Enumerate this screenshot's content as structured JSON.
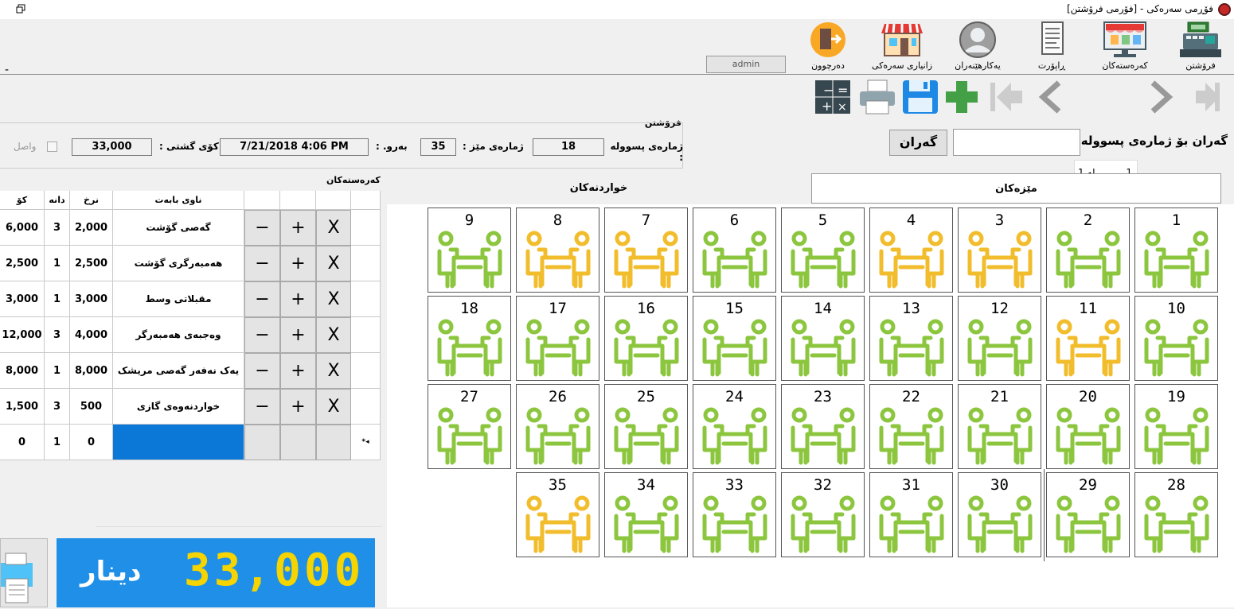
{
  "window": {
    "title": "فۆڕمی سەرەکی - [فۆرمی فرۆشتن]"
  },
  "menu": {
    "items": [
      {
        "label": "فرۆشتن",
        "icon": "cash-register-icon"
      },
      {
        "label": "کەرەستەکان",
        "icon": "monitor-store-icon"
      },
      {
        "label": "ڕاپۆرت",
        "icon": "report-icon"
      },
      {
        "label": "یەکارهێنەران",
        "icon": "user-icon"
      },
      {
        "label": "زانیاری سەرەکی",
        "icon": "shop-icon"
      },
      {
        "label": "دەرچوون",
        "icon": "exit-door-icon"
      }
    ],
    "user": "admin",
    "left_mark": "-"
  },
  "toolbar": {
    "pager_value": "1",
    "pager_label": "له 1"
  },
  "search": {
    "label": "گەران بۆ ژمارەی پسوولە :",
    "button": "گەران",
    "value": ""
  },
  "sale": {
    "title": "فرۆشتن",
    "invoice_label": "ژمارەی پسوولە :",
    "invoice_value": "18",
    "table_label": "ژمارەی مێز :",
    "table_value": "35",
    "date_label": "بەرو. :",
    "date_value": "7/21/2018 4:06 PM",
    "total_label": "کۆی گشتی :",
    "total_value": "33,000",
    "received_label": "واصل"
  },
  "items": {
    "title": "کەرەستەکان",
    "headers": {
      "total": "کۆ",
      "qty": "دانە",
      "price": "نرخ",
      "name": "ناوی بابەت"
    },
    "rows": [
      {
        "total": "6,000",
        "qty": "3",
        "price": "2,000",
        "name": "گەصی گۆشت"
      },
      {
        "total": "2,500",
        "qty": "1",
        "price": "2,500",
        "name": "هەمبەرگری گۆشت"
      },
      {
        "total": "3,000",
        "qty": "1",
        "price": "3,000",
        "name": "مقبلاتی وسط"
      },
      {
        "total": "12,000",
        "qty": "3",
        "price": "4,000",
        "name": "وەجبەی هەمبەرگر"
      },
      {
        "total": "8,000",
        "qty": "1",
        "price": "8,000",
        "name": "یەک نەفەر گەصی مریشک"
      },
      {
        "total": "1,500",
        "qty": "3",
        "price": "500",
        "name": "خواردنەوەی گازی"
      }
    ],
    "new_row": {
      "total": "0",
      "qty": "1",
      "price": "0",
      "marker": "*◂"
    },
    "remove_label": "X",
    "plus_label": "+",
    "minus_label": "−"
  },
  "tabs": {
    "tables": "مێزەکان",
    "food": "خواردنەکان"
  },
  "tables": [
    {
      "n": "1",
      "s": "free"
    },
    {
      "n": "2",
      "s": "free"
    },
    {
      "n": "3",
      "s": "busy"
    },
    {
      "n": "4",
      "s": "busy"
    },
    {
      "n": "5",
      "s": "free"
    },
    {
      "n": "6",
      "s": "free"
    },
    {
      "n": "7",
      "s": "busy"
    },
    {
      "n": "8",
      "s": "busy"
    },
    {
      "n": "9",
      "s": "free"
    },
    {
      "n": "10",
      "s": "free"
    },
    {
      "n": "11",
      "s": "busy"
    },
    {
      "n": "12",
      "s": "free"
    },
    {
      "n": "13",
      "s": "free"
    },
    {
      "n": "14",
      "s": "free"
    },
    {
      "n": "15",
      "s": "free"
    },
    {
      "n": "16",
      "s": "free"
    },
    {
      "n": "17",
      "s": "free"
    },
    {
      "n": "18",
      "s": "free"
    },
    {
      "n": "19",
      "s": "free"
    },
    {
      "n": "20",
      "s": "free"
    },
    {
      "n": "21",
      "s": "free"
    },
    {
      "n": "22",
      "s": "free"
    },
    {
      "n": "23",
      "s": "free"
    },
    {
      "n": "24",
      "s": "free"
    },
    {
      "n": "25",
      "s": "free"
    },
    {
      "n": "26",
      "s": "free"
    },
    {
      "n": "27",
      "s": "free"
    },
    {
      "n": "28",
      "s": "free"
    },
    {
      "n": "29",
      "s": "free"
    },
    {
      "n": "30",
      "s": "free"
    },
    {
      "n": "31",
      "s": "free"
    },
    {
      "n": "32",
      "s": "free"
    },
    {
      "n": "33",
      "s": "free"
    },
    {
      "n": "34",
      "s": "free"
    },
    {
      "n": "35",
      "s": "busy"
    }
  ],
  "colors": {
    "free": "#8cc63f",
    "busy": "#f2bd2c",
    "total_bg": "#1f8fe8",
    "total_fg": "#f5d400",
    "selected_cell": "#0b78d7"
  },
  "total_display": {
    "amount": "33,000",
    "currency": "دینار"
  }
}
